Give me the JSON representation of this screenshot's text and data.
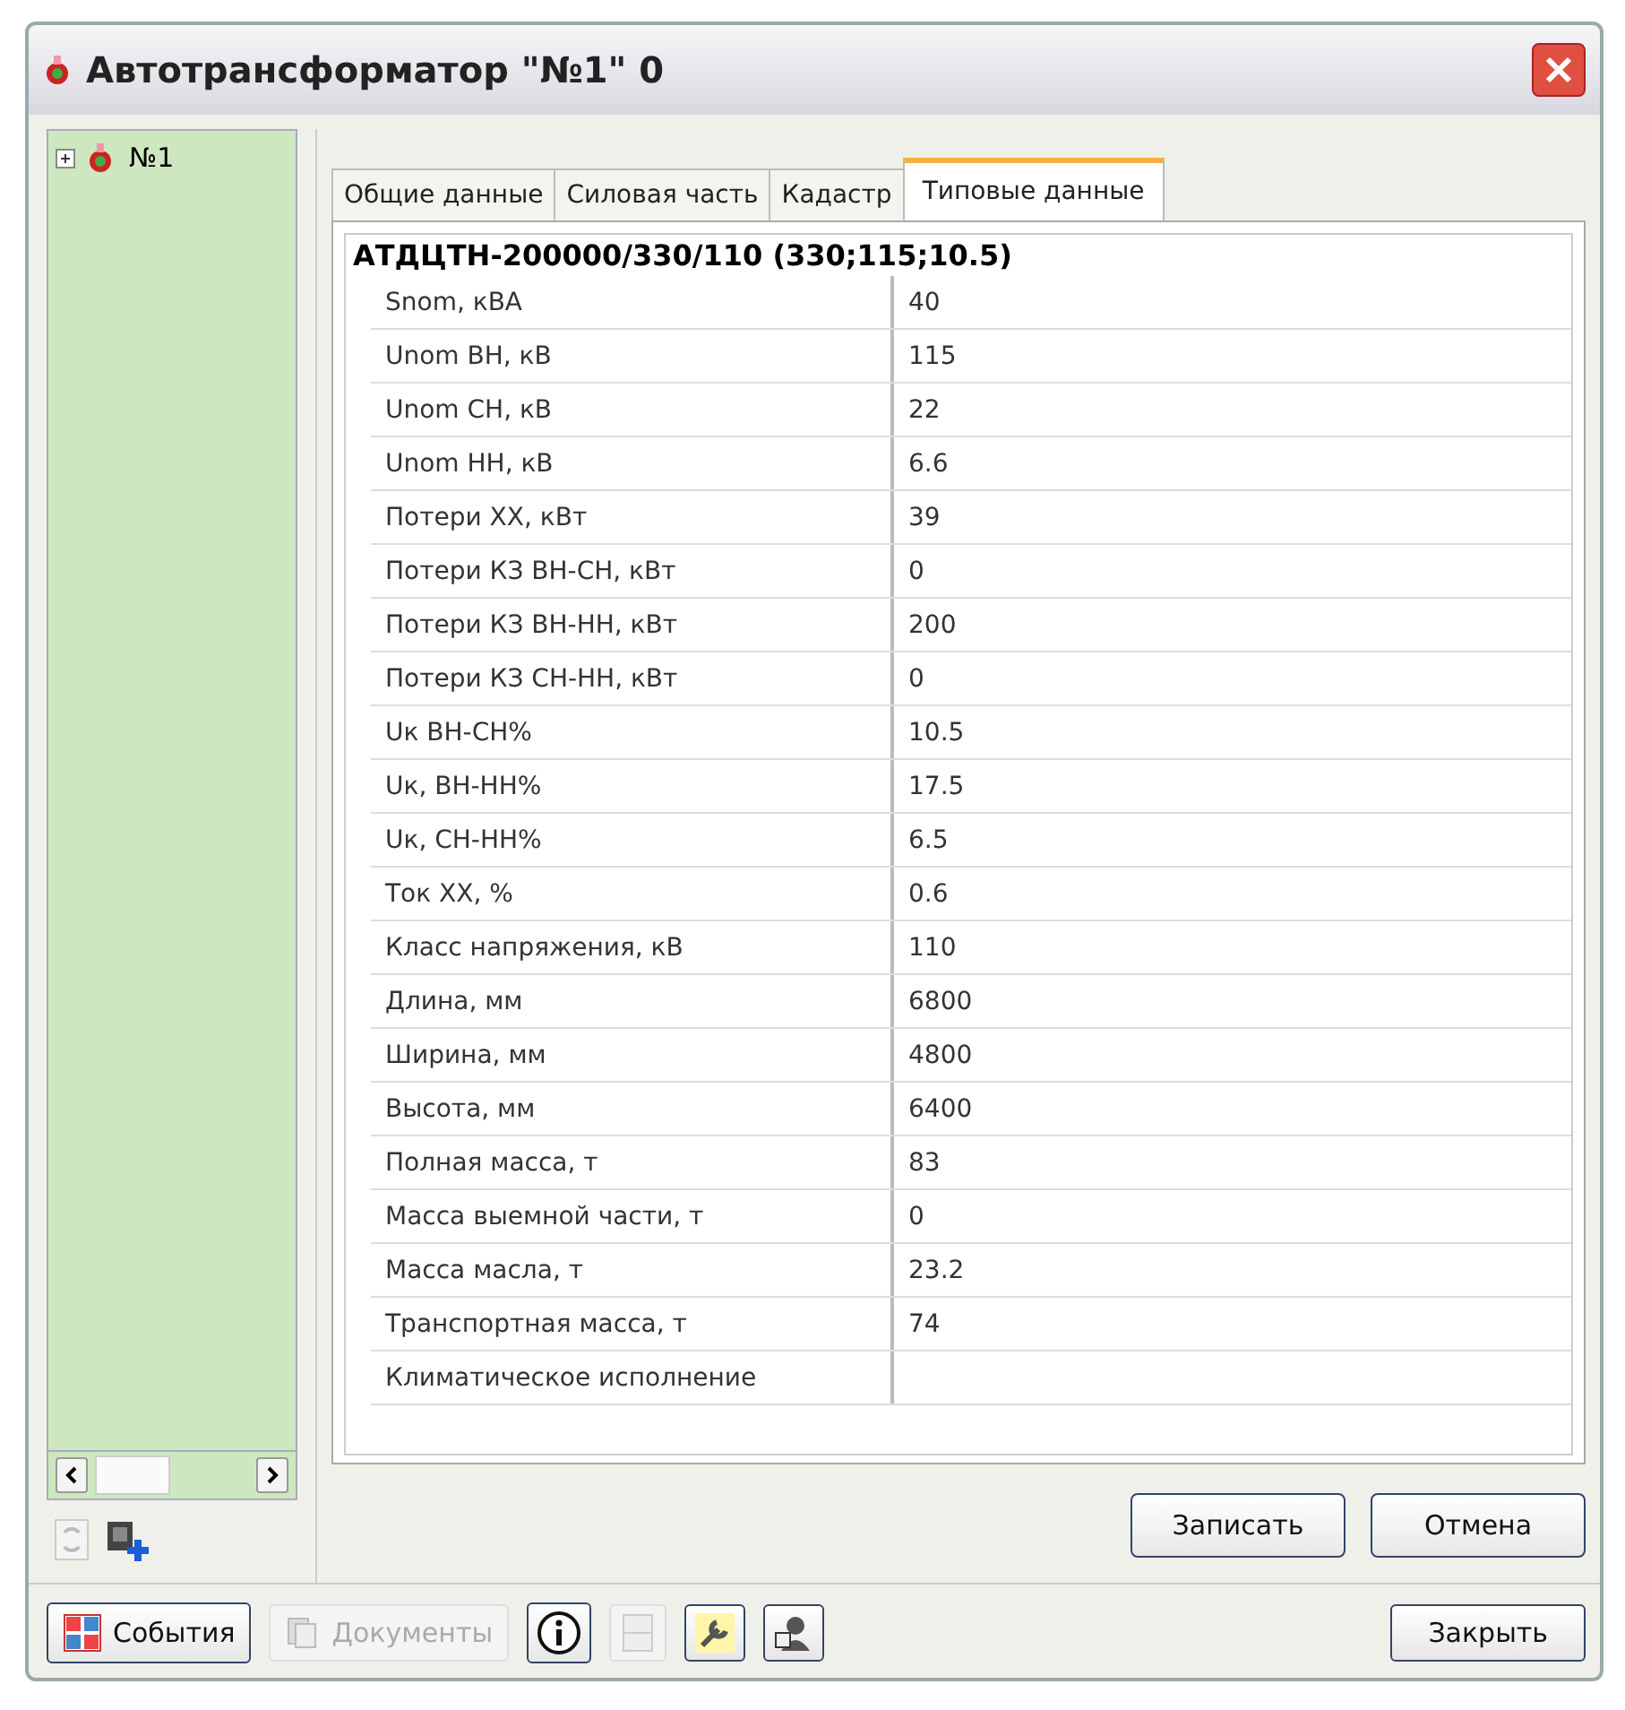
{
  "window": {
    "title": "Автотрансформатор \"№1\" 0"
  },
  "tree": {
    "items": [
      {
        "label": "№1",
        "expanded": false,
        "selected": false
      }
    ]
  },
  "tabs": [
    {
      "label": "Общие данные",
      "selected": false
    },
    {
      "label": "Силовая часть",
      "selected": false
    },
    {
      "label": "Кадастр",
      "selected": false
    },
    {
      "label": "Типовые данные",
      "selected": true
    }
  ],
  "table": {
    "title": "АТДЦТН-200000/330/110 (330;115;10.5)",
    "rows": [
      {
        "name": "Snom, кВА",
        "value": "40"
      },
      {
        "name": "Unom ВН, кВ",
        "value": "115"
      },
      {
        "name": "Unom СН, кВ",
        "value": "22"
      },
      {
        "name": "Unom НН, кВ",
        "value": "6.6"
      },
      {
        "name": "Потери ХХ, кВт",
        "value": "39"
      },
      {
        "name": "Потери КЗ ВН-СН, кВт",
        "value": "0"
      },
      {
        "name": "Потери КЗ ВН-НН, кВт",
        "value": "200"
      },
      {
        "name": "Потери КЗ СН-НН, кВт",
        "value": "0"
      },
      {
        "name": "Uк ВН-СН%",
        "value": "10.5"
      },
      {
        "name": "Uк, ВН-НН%",
        "value": "17.5"
      },
      {
        "name": "Uк, СН-НН%",
        "value": "6.5"
      },
      {
        "name": "Ток ХХ, %",
        "value": "0.6"
      },
      {
        "name": "Класс напряжения, кВ",
        "value": "110"
      },
      {
        "name": "Длина, мм",
        "value": "6800"
      },
      {
        "name": "Ширина, мм",
        "value": "4800"
      },
      {
        "name": "Высота, мм",
        "value": "6400"
      },
      {
        "name": "Полная масса, т",
        "value": "83"
      },
      {
        "name": "Масса выемной части, т",
        "value": "0"
      },
      {
        "name": "Масса масла, т",
        "value": "23.2"
      },
      {
        "name": "Транспортная масса, т",
        "value": "74"
      },
      {
        "name": "Климатическое исполнение"
      }
    ]
  },
  "form_buttons": [
    "Записать",
    "Отмена"
  ],
  "toolbar": [
    {
      "kind": "text",
      "label": "События",
      "disabled": false
    },
    {
      "kind": "text",
      "label": "Документы",
      "disabled": true
    },
    {
      "kind": "icon",
      "disabled": false
    },
    {
      "kind": "icon",
      "disabled": true
    },
    {
      "kind": "icon",
      "disabled": false
    },
    {
      "kind": "icon",
      "disabled": false
    },
    {
      "kind": "close",
      "label": "Закрыть",
      "disabled": false
    }
  ]
}
